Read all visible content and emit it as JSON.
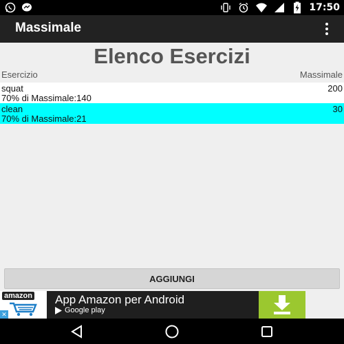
{
  "status_bar": {
    "time": "17:50",
    "icons_left": [
      "whatsapp-icon",
      "messenger-icon"
    ],
    "icons_right": [
      "vibrate-icon",
      "alarm-icon",
      "wifi-icon",
      "signal-icon",
      "battery-charging-icon"
    ]
  },
  "app_bar": {
    "title": "Massimale"
  },
  "page": {
    "title": "Elenco Esercizi",
    "col_exercise": "Esercizio",
    "col_max": "Massimale"
  },
  "exercises": [
    {
      "name": "squat",
      "max": "200",
      "pct_label": "70% di Massimale:",
      "pct_value": "140",
      "bg": "#ffffff"
    },
    {
      "name": "clean",
      "max": "30",
      "pct_label": "70% di Massimale:",
      "pct_value": "21",
      "bg": "#00ffff"
    }
  ],
  "actions": {
    "add_label": "AGGIUNGI"
  },
  "ad": {
    "logo_text": "amazon",
    "headline": "App Amazon per Android",
    "store": "Google play",
    "accent": "#9bc82f"
  },
  "nav": {
    "items": [
      "back-icon",
      "home-icon",
      "recents-icon"
    ]
  }
}
